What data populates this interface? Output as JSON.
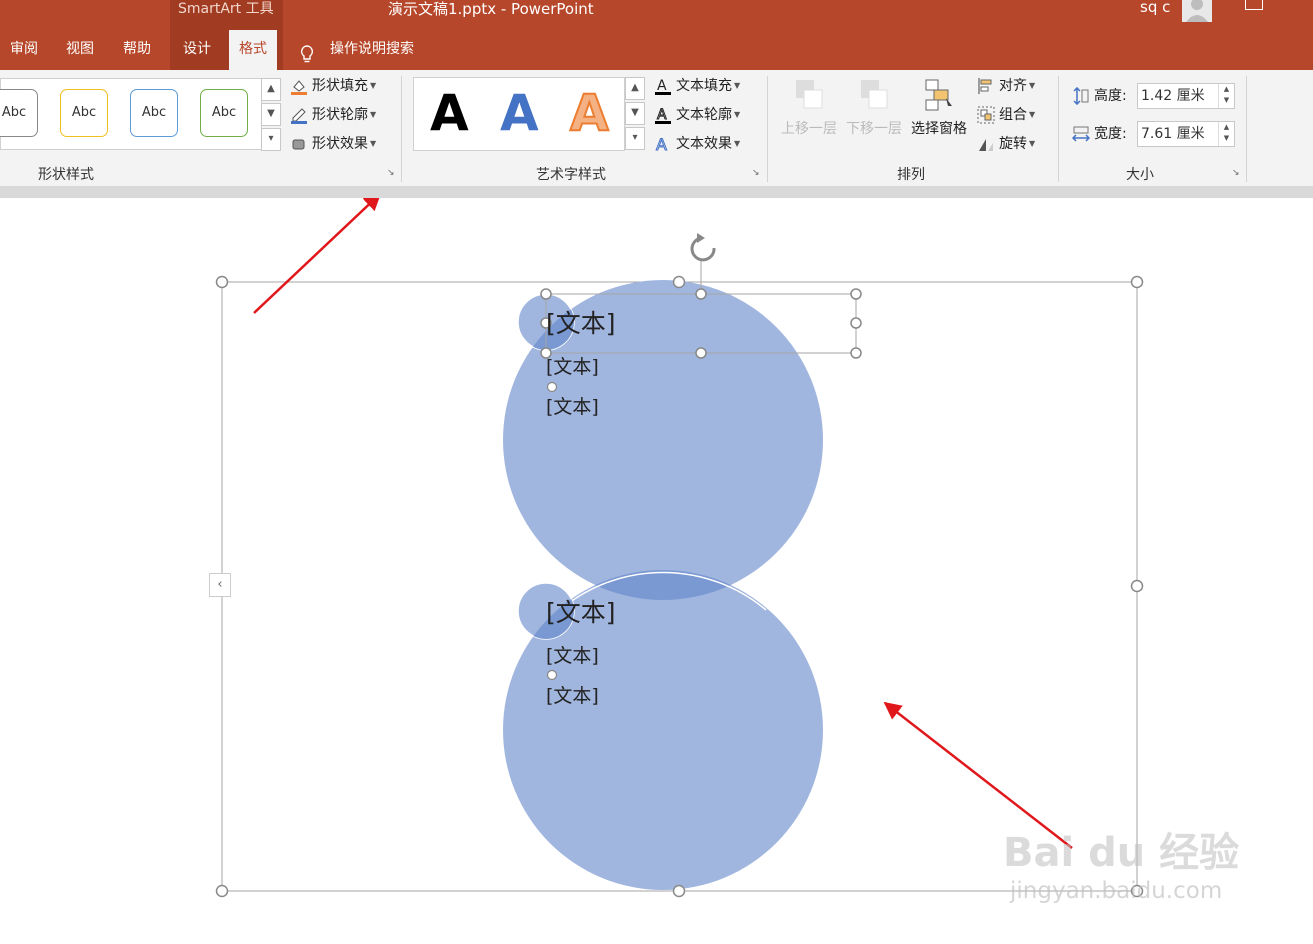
{
  "titlebar": {
    "contextual_label": "SmartArt 工具",
    "document_title": "演示文稿1.pptx  -  PowerPoint",
    "user_name": "sq c"
  },
  "tabs": [
    {
      "label": "审阅"
    },
    {
      "label": "视图"
    },
    {
      "label": "帮助"
    },
    {
      "label": "设计"
    },
    {
      "label": "格式",
      "active": true
    }
  ],
  "tell_me": "操作说明搜索",
  "ribbon": {
    "shape_styles": {
      "label": "形状样式",
      "swatch_text": "Abc",
      "fill": "形状填充",
      "outline": "形状轮廓",
      "effects": "形状效果"
    },
    "wordart_styles": {
      "label": "艺术字样式",
      "sample": "A",
      "text_fill": "文本填充",
      "text_outline": "文本轮廓",
      "text_effects": "文本效果"
    },
    "arrange": {
      "label": "排列",
      "bring_forward": "上移一层",
      "send_backward": "下移一层",
      "selection_pane": "选择窗格",
      "align": "对齐",
      "group": "组合",
      "rotate": "旋转"
    },
    "size": {
      "label": "大小",
      "height_label": "高度:",
      "height_value": "1.42 厘米",
      "width_label": "宽度:",
      "width_value": "7.61 厘米"
    }
  },
  "slide": {
    "top_node": {
      "title": "[文本]",
      "bullets": [
        "[文本]",
        "[文本]"
      ]
    },
    "bottom_node": {
      "title": "[文本]",
      "bullets": [
        "[文本]",
        "[文本]"
      ]
    }
  },
  "watermark": {
    "brand": "Bai du 经验",
    "url": "jingyan.baidu.com"
  },
  "colors": {
    "accent": "#b7472a",
    "circle_fill": "#a1b6df",
    "overlap_fill": "#7a99d3",
    "annotation_arrow": "#e0171b"
  },
  "icons": [
    "lightbulb-icon",
    "user-avatar-icon",
    "ribbon-display-icon",
    "rotate-handle-icon",
    "collapse-pane-icon"
  ]
}
